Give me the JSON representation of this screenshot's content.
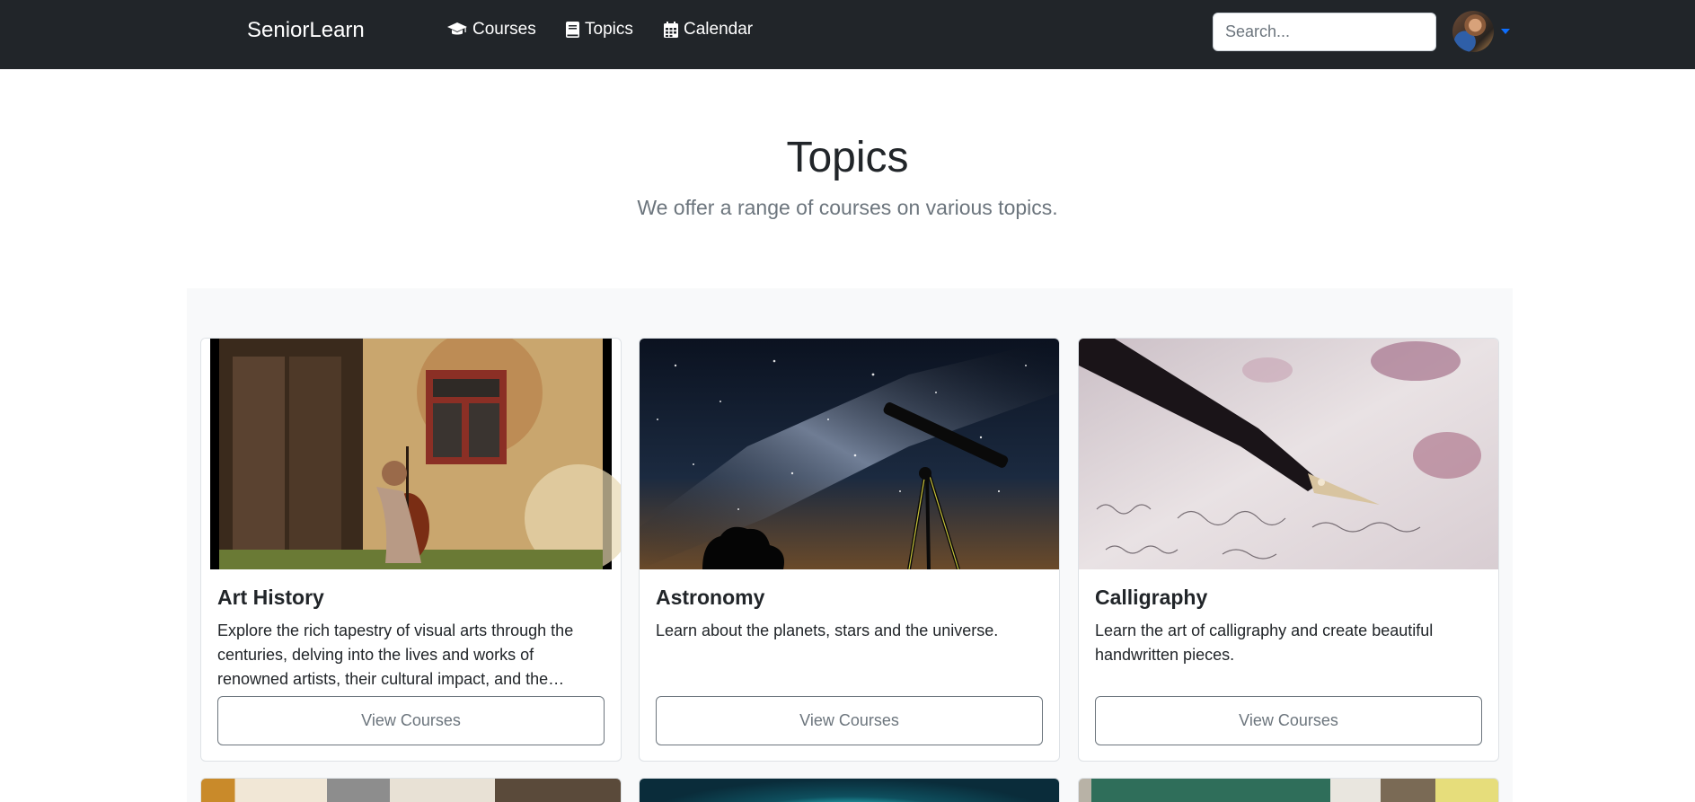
{
  "navbar": {
    "brand": "SeniorLearn",
    "links": [
      {
        "label": "Courses",
        "icon": "graduation-cap-icon"
      },
      {
        "label": "Topics",
        "icon": "book-icon"
      },
      {
        "label": "Calendar",
        "icon": "calendar-icon"
      }
    ],
    "search_placeholder": "Search...",
    "accent": "#0d6efd",
    "background": "#212529"
  },
  "header": {
    "title": "Topics",
    "subtitle": "We offer a range of courses on various topics."
  },
  "topics": [
    {
      "title": "Art History",
      "description": "Explore the rich tapestry of visual arts through the centuries, delving into the lives and works of renowned artists, their cultural impact, and the…",
      "button": "View Courses"
    },
    {
      "title": "Astronomy",
      "description": "Learn about the planets, stars and the universe.",
      "button": "View Courses"
    },
    {
      "title": "Calligraphy",
      "description": "Learn the art of calligraphy and create beautiful handwritten pieces.",
      "button": "View Courses"
    }
  ]
}
